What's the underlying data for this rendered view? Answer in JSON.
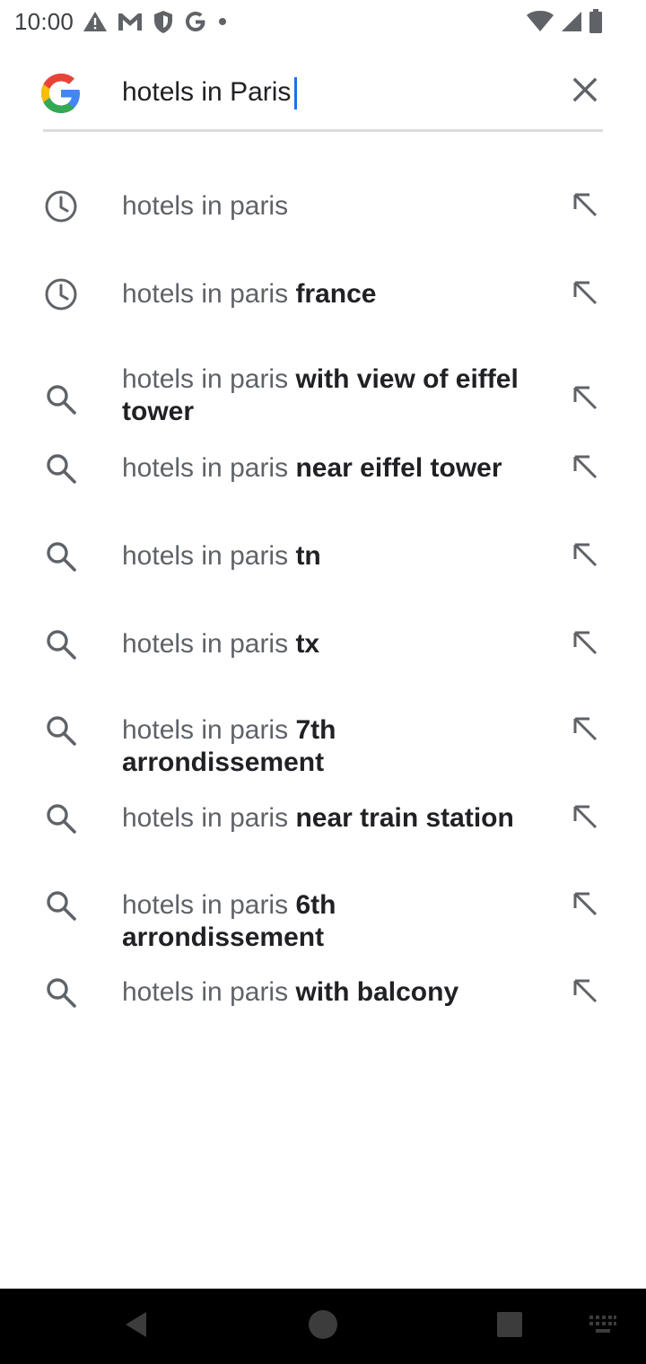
{
  "status_bar": {
    "time": "10:00",
    "left_icons": [
      "alert-icon",
      "gmail-icon",
      "shield-icon",
      "google-icon",
      "dot-icon"
    ],
    "right_icons": [
      "wifi-icon",
      "signal-icon",
      "battery-icon"
    ]
  },
  "search": {
    "query": "hotels in Paris",
    "logo": "google-logo",
    "clear_icon": "close-icon"
  },
  "suggestions": [
    {
      "type": "history",
      "icon": "history-icon",
      "prefix": "hotels in paris",
      "suffix": ""
    },
    {
      "type": "history",
      "icon": "history-icon",
      "prefix": "hotels in paris",
      "suffix": " france"
    },
    {
      "type": "search",
      "icon": "search-icon",
      "prefix": "hotels in paris",
      "suffix": " with view of eiffel tower"
    },
    {
      "type": "search",
      "icon": "search-icon",
      "prefix": "hotels in paris",
      "suffix": " near eiffel tower"
    },
    {
      "type": "search",
      "icon": "search-icon",
      "prefix": "hotels in paris",
      "suffix": " tn"
    },
    {
      "type": "search",
      "icon": "search-icon",
      "prefix": "hotels in paris",
      "suffix": " tx"
    },
    {
      "type": "search",
      "icon": "search-icon",
      "prefix": "hotels in paris",
      "suffix": " 7th arrondissement"
    },
    {
      "type": "search",
      "icon": "search-icon",
      "prefix": "hotels in paris",
      "suffix": " near train station"
    },
    {
      "type": "search",
      "icon": "search-icon",
      "prefix": "hotels in paris",
      "suffix": " 6th arrondissement"
    },
    {
      "type": "search",
      "icon": "search-icon",
      "prefix": "hotels in paris",
      "suffix": " with balcony"
    }
  ],
  "nav_bar": {
    "buttons": [
      "back-icon",
      "home-icon",
      "recents-icon",
      "keyboard-icon"
    ]
  },
  "colors": {
    "accent": "#1a73e8",
    "icon_gray": "#5f6368",
    "nav_background": "#000000"
  }
}
